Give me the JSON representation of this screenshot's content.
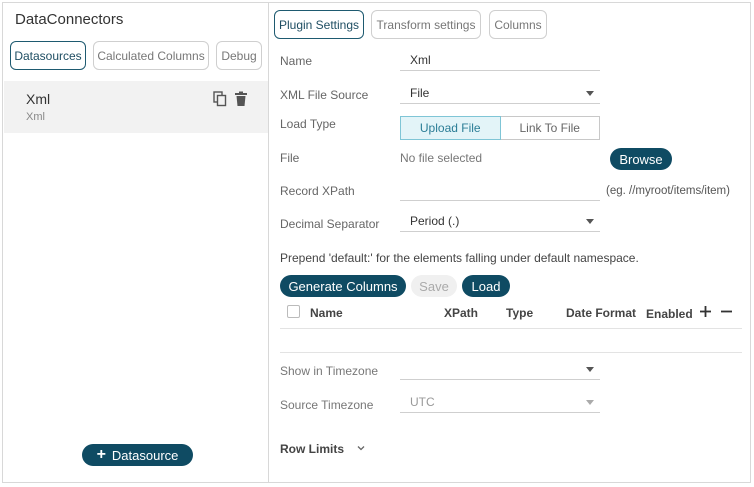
{
  "app": {
    "title": "DataConnectors"
  },
  "left_tabs": [
    {
      "label": "Datasources"
    },
    {
      "label": "Calculated Columns"
    },
    {
      "label": "Debug"
    }
  ],
  "datasource": {
    "name": "Xml",
    "type": "Xml"
  },
  "add_button": {
    "label": "Datasource"
  },
  "right_tabs": [
    {
      "label": "Plugin Settings"
    },
    {
      "label": "Transform settings"
    },
    {
      "label": "Columns"
    }
  ],
  "form": {
    "name_label": "Name",
    "name_value": "Xml",
    "xml_source_label": "XML File Source",
    "xml_source_value": "File",
    "load_type_label": "Load Type",
    "load_type_options": [
      "Upload File",
      "Link To File"
    ],
    "file_label": "File",
    "file_value": "No file selected",
    "browse_label": "Browse",
    "record_xpath_label": "Record XPath",
    "record_xpath_value": "",
    "record_xpath_hint": "(eg. //myroot/items/item)",
    "decimal_label": "Decimal Separator",
    "decimal_value": "Period (.)",
    "namespace_note": "Prepend 'default:' for the elements falling under default namespace.",
    "generate_label": "Generate Columns",
    "save_label": "Save",
    "load_label": "Load",
    "columns_header": [
      "Name",
      "XPath",
      "Type",
      "Date Format",
      "Enabled"
    ],
    "timezone_label": "Show in Timezone",
    "timezone_value": "",
    "source_tz_label": "Source Timezone",
    "source_tz_value": "UTC",
    "row_limits_label": "Row Limits"
  }
}
